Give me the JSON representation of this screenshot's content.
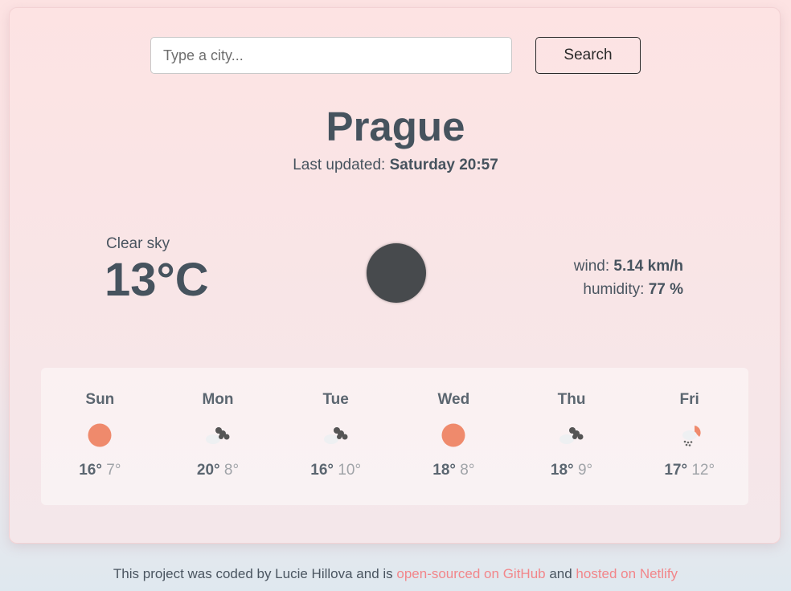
{
  "search": {
    "placeholder": "Type a city...",
    "value": "",
    "button_label": "Search"
  },
  "current": {
    "city": "Prague",
    "updated_label": "Last updated: ",
    "updated_value": "Saturday 20:57",
    "description": "Clear sky",
    "temperature": "13°C",
    "icon": "moon-icon",
    "wind_label": "wind: ",
    "wind_value": "5.14 km/h",
    "humidity_label": "humidity: ",
    "humidity_value": "77 %"
  },
  "forecast": [
    {
      "day": "Sun",
      "max": "16°",
      "min": "7°",
      "icon": "sun-icon"
    },
    {
      "day": "Mon",
      "max": "20°",
      "min": "8°",
      "icon": "broken-clouds-icon"
    },
    {
      "day": "Tue",
      "max": "16°",
      "min": "10°",
      "icon": "broken-clouds-icon"
    },
    {
      "day": "Wed",
      "max": "18°",
      "min": "8°",
      "icon": "sun-icon"
    },
    {
      "day": "Thu",
      "max": "18°",
      "min": "9°",
      "icon": "broken-clouds-icon"
    },
    {
      "day": "Fri",
      "max": "17°",
      "min": "12°",
      "icon": "rain-sun-icon"
    }
  ],
  "footer": {
    "text1": "This project was coded by Lucie Hillova and is ",
    "link1": "open-sourced on GitHub",
    "text2": " and ",
    "link2": "hosted on Netlify"
  },
  "colors": {
    "accent": "#f2868a",
    "sun": "#ef8a6c",
    "text": "#46535e"
  }
}
